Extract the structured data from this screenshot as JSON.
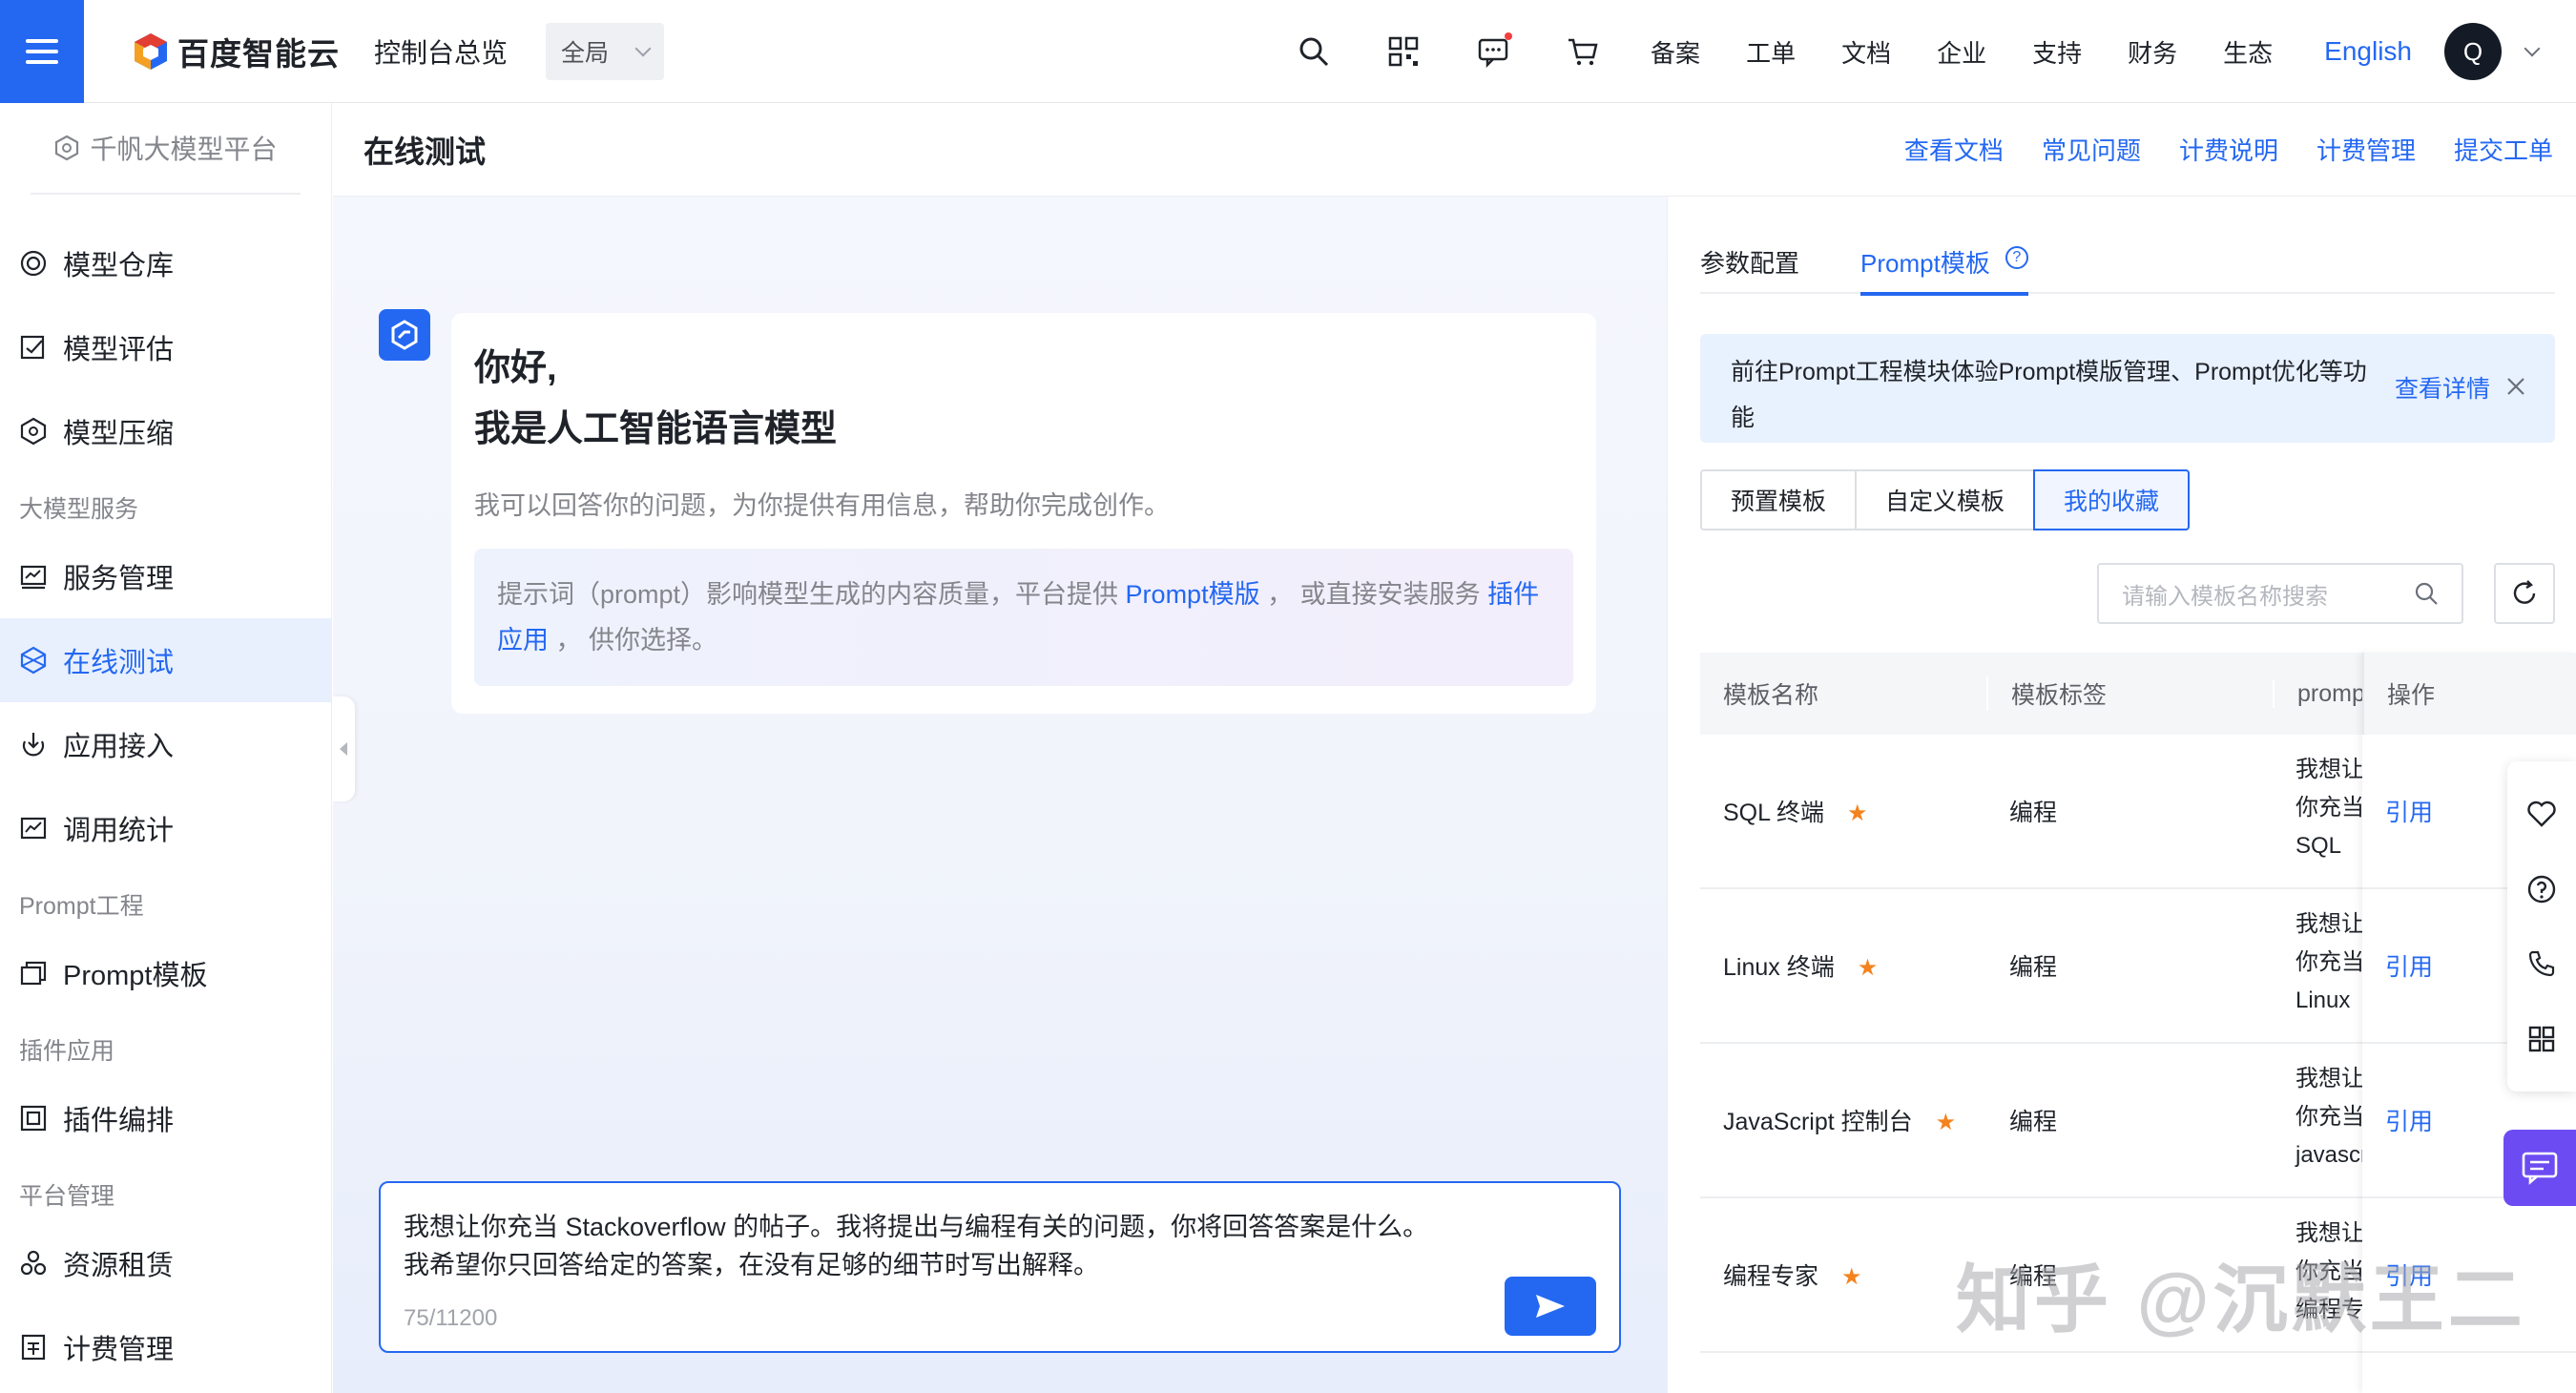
{
  "topbar": {
    "logo_text": "百度智能云",
    "console_link": "控制台总览",
    "region": "全局",
    "items": [
      "备案",
      "工单",
      "文档",
      "企业",
      "支持",
      "财务",
      "生态"
    ],
    "language": "English",
    "avatar_letter": "Q"
  },
  "sidebar": {
    "platform": "千帆大模型平台",
    "items_top": [
      {
        "label": "模型仓库",
        "icon": "model-repo-icon"
      },
      {
        "label": "模型评估",
        "icon": "model-eval-icon"
      },
      {
        "label": "模型压缩",
        "icon": "model-compress-icon"
      }
    ],
    "group_service": "大模型服务",
    "items_service": [
      {
        "label": "服务管理",
        "icon": "service-manage-icon"
      },
      {
        "label": "在线测试",
        "icon": "online-test-icon"
      },
      {
        "label": "应用接入",
        "icon": "app-access-icon"
      },
      {
        "label": "调用统计",
        "icon": "call-stats-icon"
      }
    ],
    "group_prompt": "Prompt工程",
    "items_prompt": [
      {
        "label": "Prompt模板",
        "icon": "prompt-template-icon"
      }
    ],
    "group_plugin": "插件应用",
    "items_plugin": [
      {
        "label": "插件编排",
        "icon": "plugin-orchestrate-icon"
      }
    ],
    "group_platform": "平台管理",
    "items_platform": [
      {
        "label": "资源租赁",
        "icon": "resource-rent-icon"
      },
      {
        "label": "计费管理",
        "icon": "billing-manage-icon"
      }
    ]
  },
  "page": {
    "title": "在线测试",
    "links": [
      "查看文档",
      "常见问题",
      "计费说明",
      "计费管理",
      "提交工单"
    ]
  },
  "chat": {
    "greeting_line1": "你好,",
    "greeting_line2": "我是人工智能语言模型",
    "intro": "我可以回答你的问题，为你提供有用信息，帮助你完成创作。",
    "tip_prefix": "提示词（prompt）影响模型生成的内容质量，平台提供 ",
    "tip_link1": "Prompt模版",
    "tip_middle": " ， 或直接安装服务 ",
    "tip_link2": "插件应用",
    "tip_suffix": " ， 供你选择。",
    "input_line1": "我想让你充当 Stackoverflow 的帖子。我将提出与编程有关的问题，你将回答答案是什么。",
    "input_line2": "我希望你只回答给定的答案，在没有足够的细节时写出解释。",
    "counter": "75/11200"
  },
  "panel": {
    "tab_params": "参数配置",
    "tab_prompt": "Prompt模板",
    "notice_text": "前往Prompt工程模块体验Prompt模版管理、Prompt优化等功能",
    "notice_detail": "查看详情",
    "seg": [
      "预置模板",
      "自定义模板",
      "我的收藏"
    ],
    "search_placeholder": "请输入模板名称搜索",
    "columns": [
      "模板名称",
      "模板标签",
      "prompt",
      "操作"
    ],
    "rows": [
      {
        "name": "SQL 终端",
        "tag": "编程",
        "prompt": "我想让你充当 SQL 的例子数据库。终端。",
        "op": "引用"
      },
      {
        "name": "Linux 终端",
        "tag": "编程",
        "prompt": "我想让你充当 Linux 终端。我将输入命令，",
        "op": "引用"
      },
      {
        "name": "JavaScript 控制台",
        "tag": "编程",
        "prompt": "我想让你充当 javascript 控制台。我将输入",
        "op": "引用"
      },
      {
        "name": "编程专家",
        "tag": "编程",
        "prompt": "我想让你充当编程专家。有...",
        "op": "引用"
      }
    ]
  },
  "watermark": "知乎 @沉默王二",
  "colors": {
    "accent": "#2468f2",
    "star": "#f4831f",
    "float_chat": "#6c4cf2"
  }
}
